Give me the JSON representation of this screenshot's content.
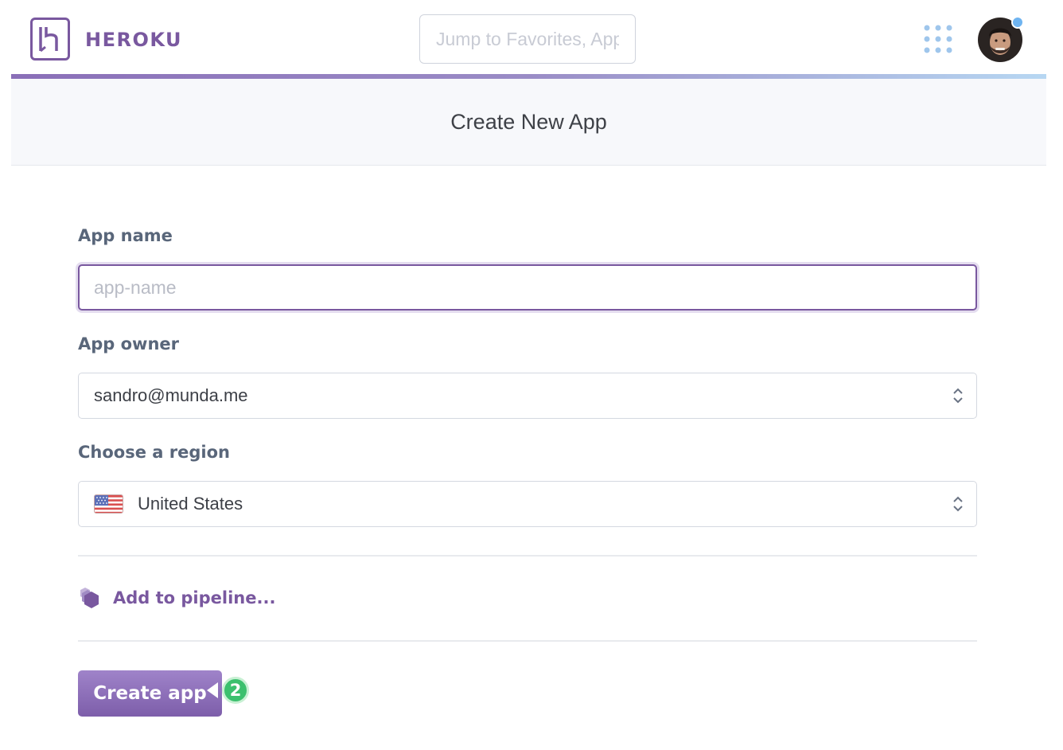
{
  "header": {
    "brand": "HEROKU",
    "search_placeholder": "Jump to Favorites, Apps, Pipelines, Spaces..."
  },
  "page": {
    "title": "Create New App"
  },
  "form": {
    "app_name_label": "App name",
    "app_name_placeholder": "app-name",
    "app_name_value": "",
    "owner_label": "App owner",
    "owner_value": "sandro@munda.me",
    "region_label": "Choose a region",
    "region_value": "United States",
    "pipeline_link": "Add to pipeline...",
    "submit_label": "Create app"
  },
  "annotation": {
    "step_number": "2"
  },
  "colors": {
    "brand": "#79589f",
    "step_badge": "#3cc06e",
    "notification_dot": "#6fb4f0"
  },
  "icons": {
    "logo": "heroku-logo-icon",
    "apps": "apps-grid-icon",
    "select": "chevron-updown-icon",
    "flag": "us-flag-icon",
    "pipeline": "pipeline-hexagon-icon"
  }
}
